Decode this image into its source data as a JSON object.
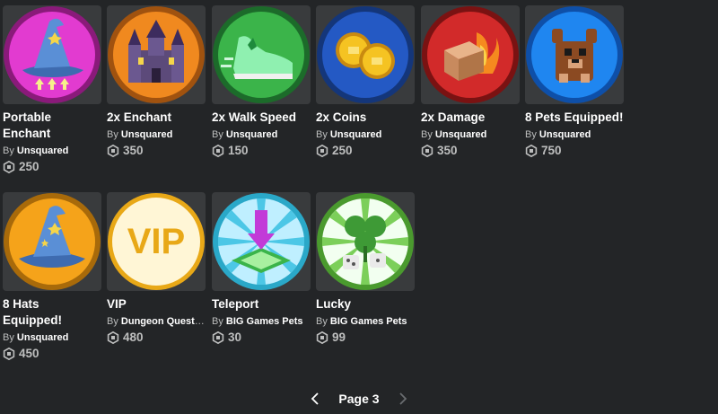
{
  "items": [
    {
      "name": "Portable Enchant",
      "by": "By",
      "creator": "Unsquared",
      "price": "250",
      "icon": "wizard-hat-arrows-icon"
    },
    {
      "name": "2x Enchant",
      "by": "By",
      "creator": "Unsquared",
      "price": "350",
      "icon": "castle-icon"
    },
    {
      "name": "2x Walk Speed",
      "by": "By",
      "creator": "Unsquared",
      "price": "150",
      "icon": "sneaker-icon"
    },
    {
      "name": "2x Coins",
      "by": "By",
      "creator": "Unsquared",
      "price": "250",
      "icon": "coins-icon"
    },
    {
      "name": "2x Damage",
      "by": "By",
      "creator": "Unsquared",
      "price": "350",
      "icon": "burning-box-icon"
    },
    {
      "name": "8 Pets Equipped!",
      "by": "By",
      "creator": "Unsquared",
      "price": "750",
      "icon": "bear-pet-icon"
    },
    {
      "name": "8 Hats Equipped!",
      "by": "By",
      "creator": "Unsquared",
      "price": "450",
      "icon": "wizard-hat-icon"
    },
    {
      "name": "VIP",
      "by": "By",
      "creator": "Dungeon Quest b...",
      "price": "480",
      "icon": "vip-badge-icon"
    },
    {
      "name": "Teleport",
      "by": "By",
      "creator": "BIG Games Pets",
      "price": "30",
      "icon": "teleport-pad-icon"
    },
    {
      "name": "Lucky",
      "by": "By",
      "creator": "BIG Games Pets",
      "price": "99",
      "icon": "clover-dice-icon"
    }
  ],
  "pager": {
    "label": "Page 3",
    "prev": "chevron-left-icon",
    "next": "chevron-right-icon"
  },
  "colors": {
    "background": "#232527",
    "card": "#393b3d",
    "muted": "#bdbebe"
  }
}
